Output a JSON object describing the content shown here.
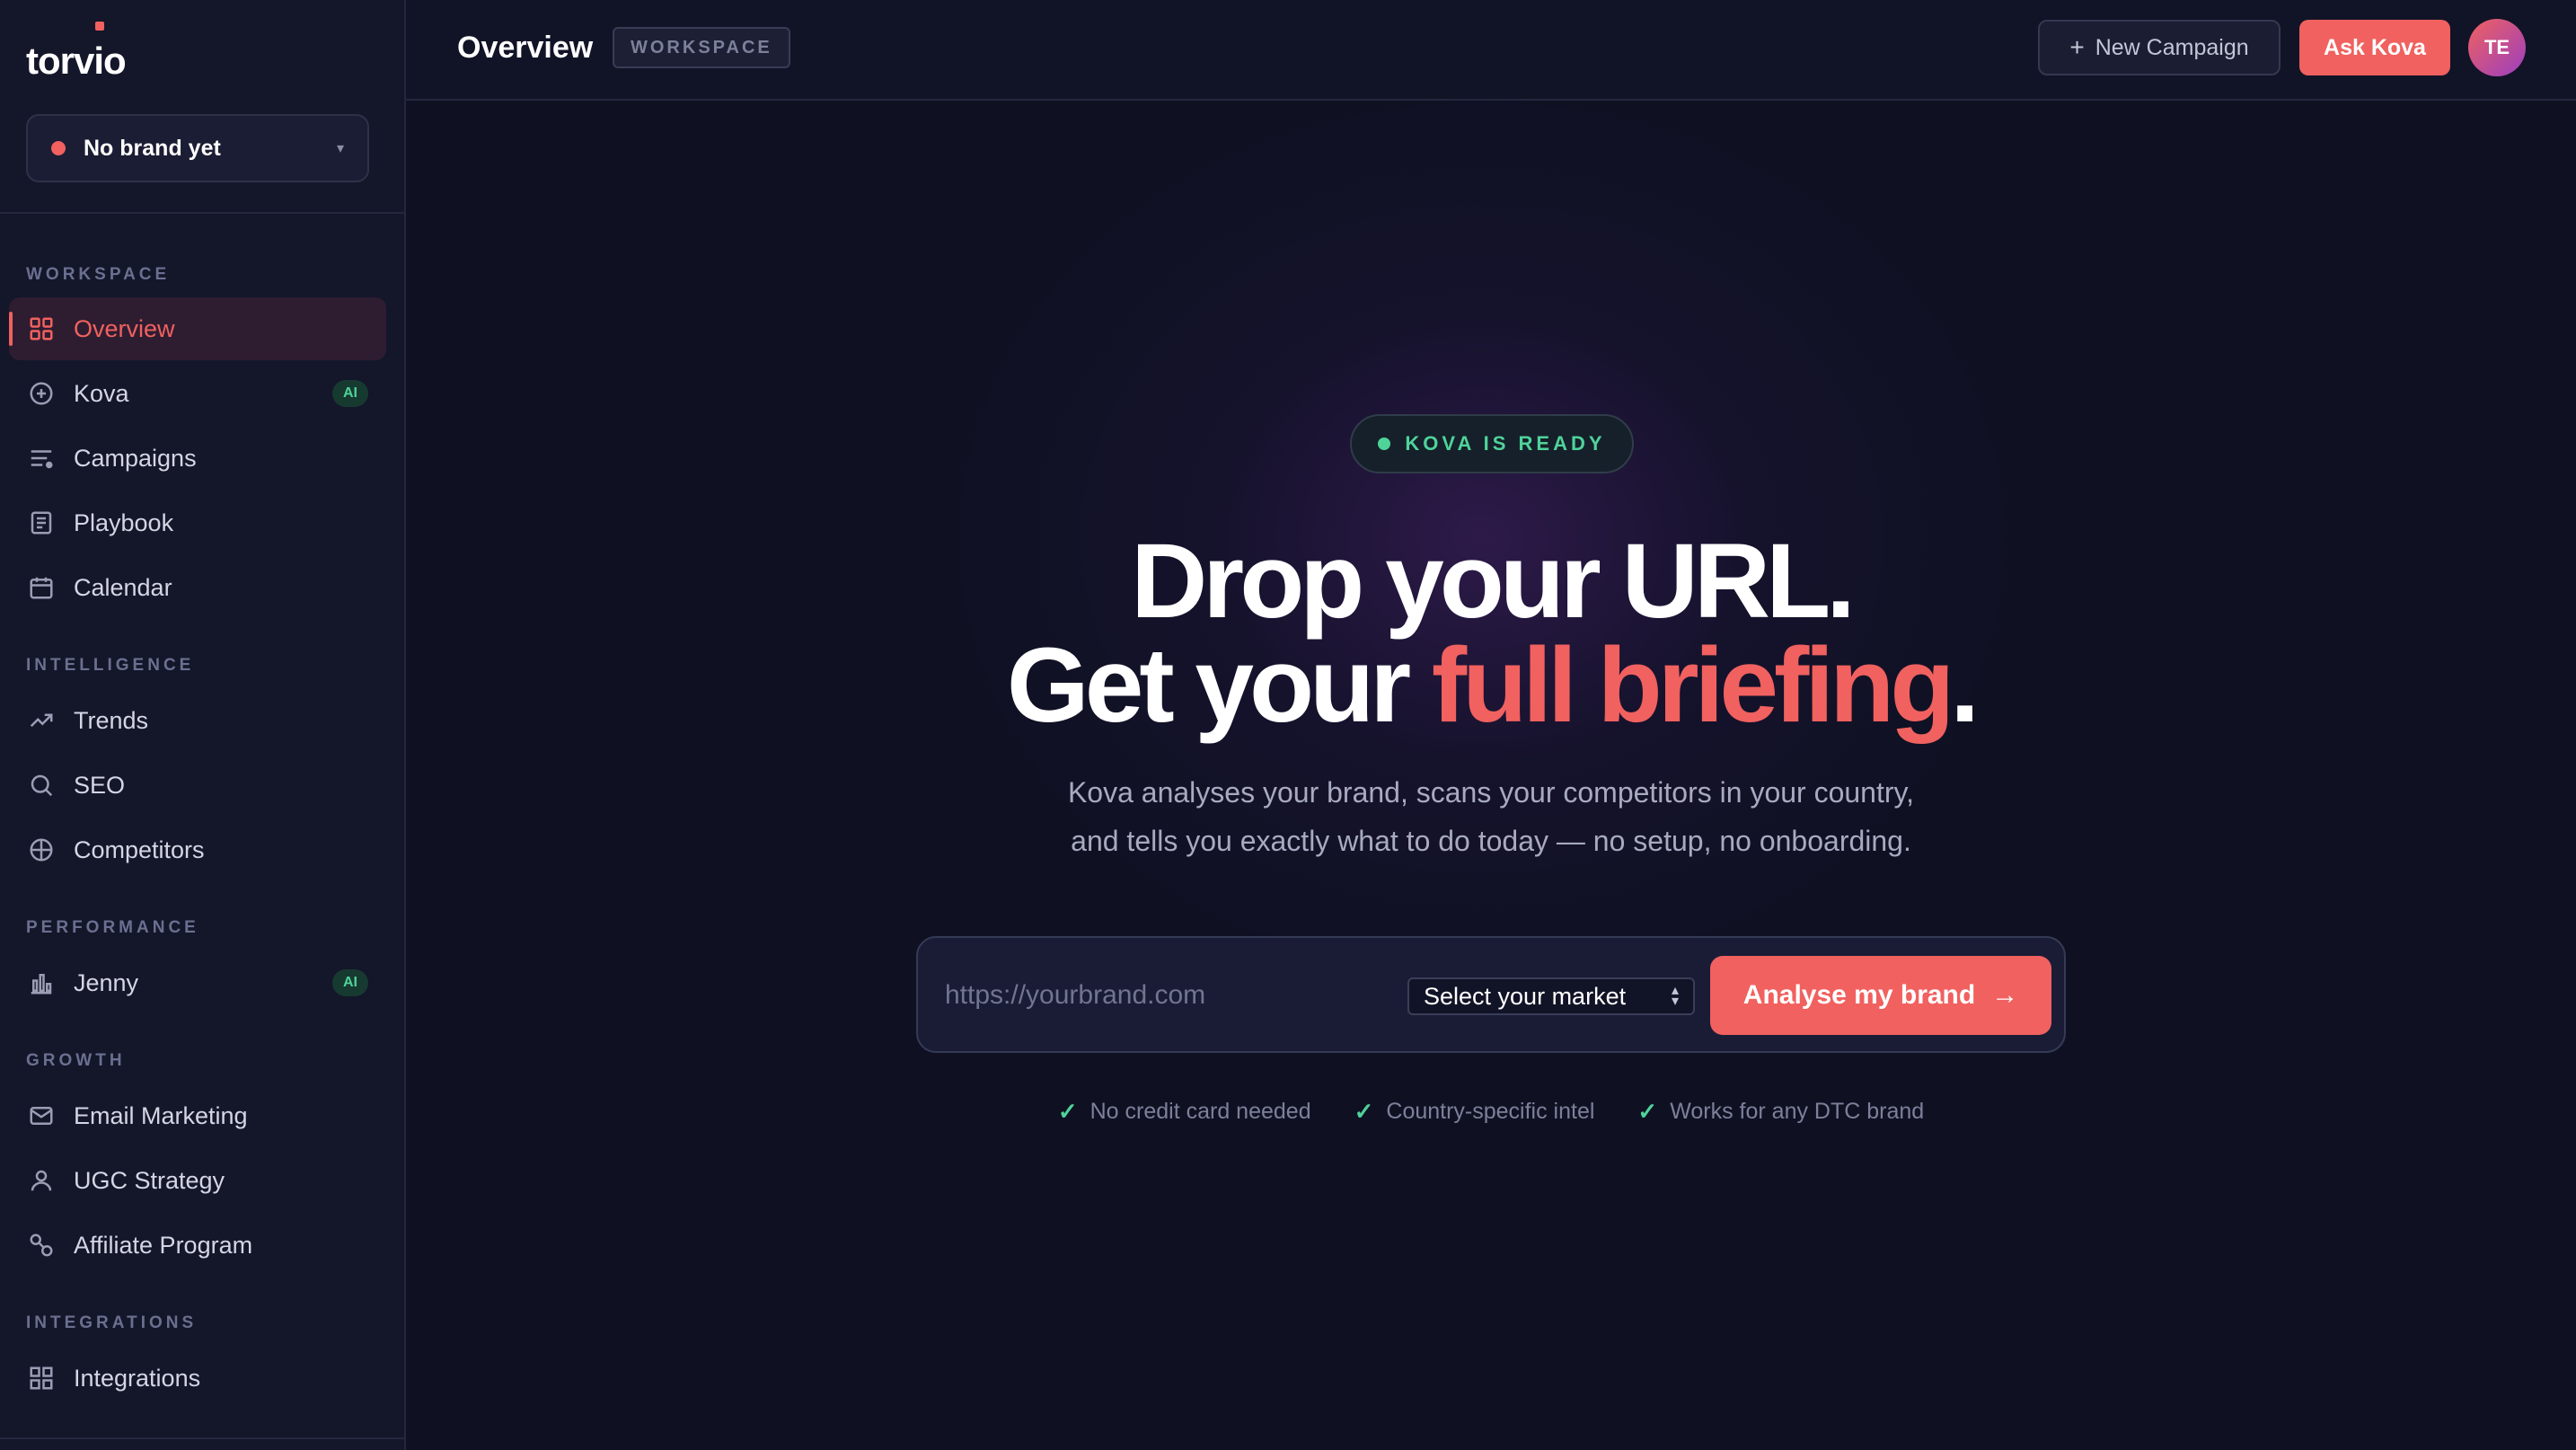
{
  "brand": {
    "logo": "torvio",
    "selector_label": "No brand yet"
  },
  "sidebar": {
    "sections": {
      "workspace": "WORKSPACE",
      "intelligence": "INTELLIGENCE",
      "performance": "PERFORMANCE",
      "growth": "GROWTH",
      "integrations": "INTEGRATIONS"
    },
    "items": [
      {
        "label": "Overview",
        "icon": "grid-icon",
        "active": true
      },
      {
        "label": "Kova",
        "icon": "sparkle-circle-icon",
        "badge": "AI"
      },
      {
        "label": "Campaigns",
        "icon": "list-icon"
      },
      {
        "label": "Playbook",
        "icon": "book-icon"
      },
      {
        "label": "Calendar",
        "icon": "calendar-icon"
      },
      {
        "label": "Trends",
        "icon": "trend-up-icon"
      },
      {
        "label": "SEO",
        "icon": "search-icon"
      },
      {
        "label": "Competitors",
        "icon": "crosshair-icon"
      },
      {
        "label": "Jenny",
        "icon": "bar-chart-icon",
        "badge": "AI"
      },
      {
        "label": "Email Marketing",
        "icon": "mail-icon"
      },
      {
        "label": "UGC Strategy",
        "icon": "user-icon"
      },
      {
        "label": "Affiliate Program",
        "icon": "link-icon"
      },
      {
        "label": "Integrations",
        "icon": "apps-icon"
      }
    ]
  },
  "header": {
    "title": "Overview",
    "tag": "WORKSPACE",
    "new_campaign": "New Campaign",
    "ask": "Ask Kova",
    "avatar_initials": "TE"
  },
  "hero": {
    "status": "KOVA IS READY",
    "line1": "Drop your URL.",
    "line2_prefix": "Get your ",
    "line2_accent": "full briefing",
    "line2_suffix": ".",
    "sub1": "Kova analyses your brand, scans your competitors in your country,",
    "sub2": "and tells you exactly what to do today — no setup, no onboarding.",
    "url_placeholder": "https://yourbrand.com",
    "market_select": "Select your market",
    "cta": "Analyse my brand",
    "perks": [
      "No credit card needed",
      "Country-specific intel",
      "Works for any DTC brand"
    ]
  },
  "colors": {
    "accent": "#f0615f",
    "success": "#4fd39a",
    "background": "#0f1123",
    "sidebar": "#14162a"
  }
}
